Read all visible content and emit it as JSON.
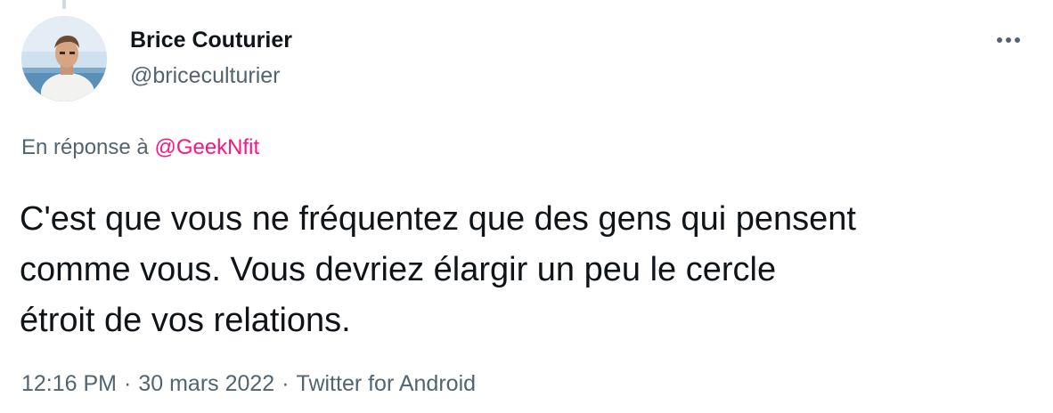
{
  "tweet": {
    "author": {
      "name": "Brice Couturier",
      "handle": "@briceculturier",
      "avatar": "profile-photo"
    },
    "more_icon": "more-horizontal-icon",
    "reply": {
      "prefix": "En réponse à",
      "mention": "@GeekNfit"
    },
    "text_lines": [
      "C'est que vous ne fréquentez que des gens qui pensent",
      "comme vous. Vous devriez élargir un peu le cercle",
      "étroit de vos relations."
    ],
    "meta": {
      "time": "12:16 PM",
      "separator": "·",
      "date": "30 mars 2022",
      "source": "Twitter for Android"
    }
  },
  "colors": {
    "text_primary": "#0f1419",
    "text_secondary": "#536471",
    "mention": "#f91880",
    "thread_line": "#cfd9de"
  }
}
